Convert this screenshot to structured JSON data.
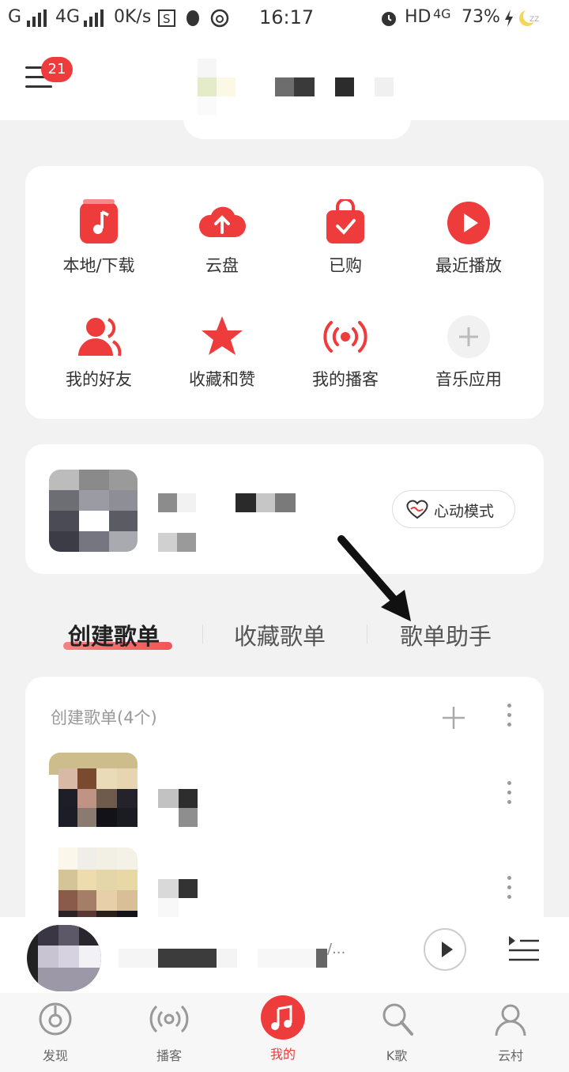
{
  "status_bar": {
    "carrier": "G",
    "network1": "4G",
    "speed": "0K/s",
    "time": "16:17",
    "network2": "HD",
    "network3": "4G",
    "battery": "73%"
  },
  "header": {
    "notification_count": "21"
  },
  "quick_grid": {
    "items": [
      {
        "label": "本地/下载",
        "icon": "music-note-icon"
      },
      {
        "label": "云盘",
        "icon": "cloud-upload-icon"
      },
      {
        "label": "已购",
        "icon": "shopping-bag-check-icon"
      },
      {
        "label": "最近播放",
        "icon": "play-circle-icon"
      },
      {
        "label": "我的好友",
        "icon": "friends-icon"
      },
      {
        "label": "收藏和赞",
        "icon": "star-icon"
      },
      {
        "label": "我的播客",
        "icon": "broadcast-icon"
      },
      {
        "label": "音乐应用",
        "icon": "plus-icon"
      }
    ]
  },
  "heart_mode": {
    "label": "心动模式"
  },
  "tabs": {
    "items": [
      "创建歌单",
      "收藏歌单",
      "歌单助手"
    ],
    "active": "创建歌单"
  },
  "playlist_section": {
    "title": "创建歌单(4个)"
  },
  "mini_player": {
    "song_suffix": "/..."
  },
  "bottom_nav": {
    "items": [
      {
        "label": "发现",
        "icon": "netease-logo-icon"
      },
      {
        "label": "播客",
        "icon": "broadcast-icon"
      },
      {
        "label": "我的",
        "icon": "music-note-icon"
      },
      {
        "label": "K歌",
        "icon": "microphone-icon"
      },
      {
        "label": "云村",
        "icon": "community-icon"
      }
    ],
    "active": "我的"
  },
  "colors": {
    "accent": "#ee3b3b",
    "background": "#f2f2f2"
  }
}
